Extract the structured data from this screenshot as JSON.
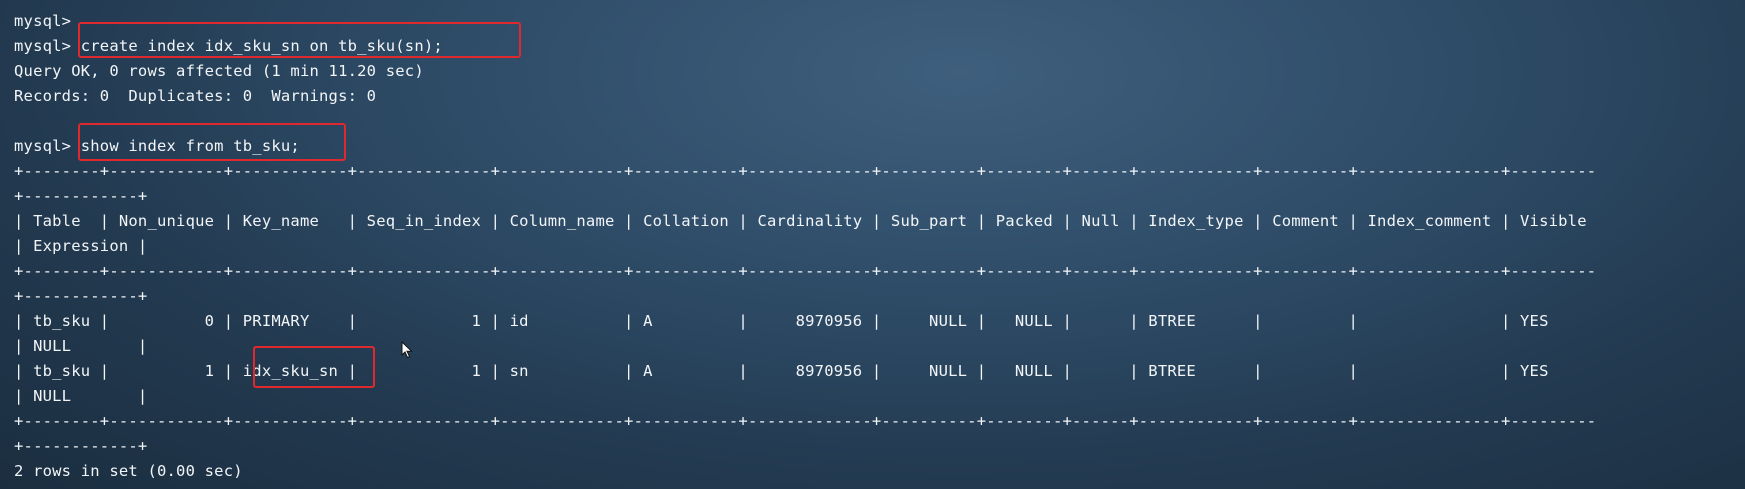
{
  "terminal": {
    "lines": [
      "mysql>",
      "mysql> create index idx_sku_sn on tb_sku(sn);",
      "Query OK, 0 rows affected (1 min 11.20 sec)",
      "Records: 0  Duplicates: 0  Warnings: 0",
      "",
      "mysql> show index from tb_sku;",
      "+--------+------------+------------+--------------+-------------+-----------+-------------+----------+--------+------+------------+---------+---------------+---------",
      "+------------+",
      "| Table  | Non_unique | Key_name   | Seq_in_index | Column_name | Collation | Cardinality | Sub_part | Packed | Null | Index_type | Comment | Index_comment | Visible",
      "| Expression |",
      "+--------+------------+------------+--------------+-------------+-----------+-------------+----------+--------+------+------------+---------+---------------+---------",
      "+------------+",
      "| tb_sku |          0 | PRIMARY    |            1 | id          | A         |     8970956 |     NULL |   NULL |      | BTREE      |         |               | YES",
      "| NULL       |",
      "| tb_sku |          1 | idx_sku_sn |            1 | sn          | A         |     8970956 |     NULL |   NULL |      | BTREE      |         |               | YES",
      "| NULL       |",
      "+--------+------------+------------+--------------+-------------+-----------+-------------+----------+--------+------+------------+---------+---------------+---------",
      "+------------+",
      "2 rows in set (0.00 sec)"
    ]
  },
  "colors": {
    "highlight_border": "#e0282f",
    "terminal_text": "#f2f5f8",
    "background": "#2f4d69"
  },
  "cursor": {
    "icon": "mouse-pointer-icon"
  }
}
